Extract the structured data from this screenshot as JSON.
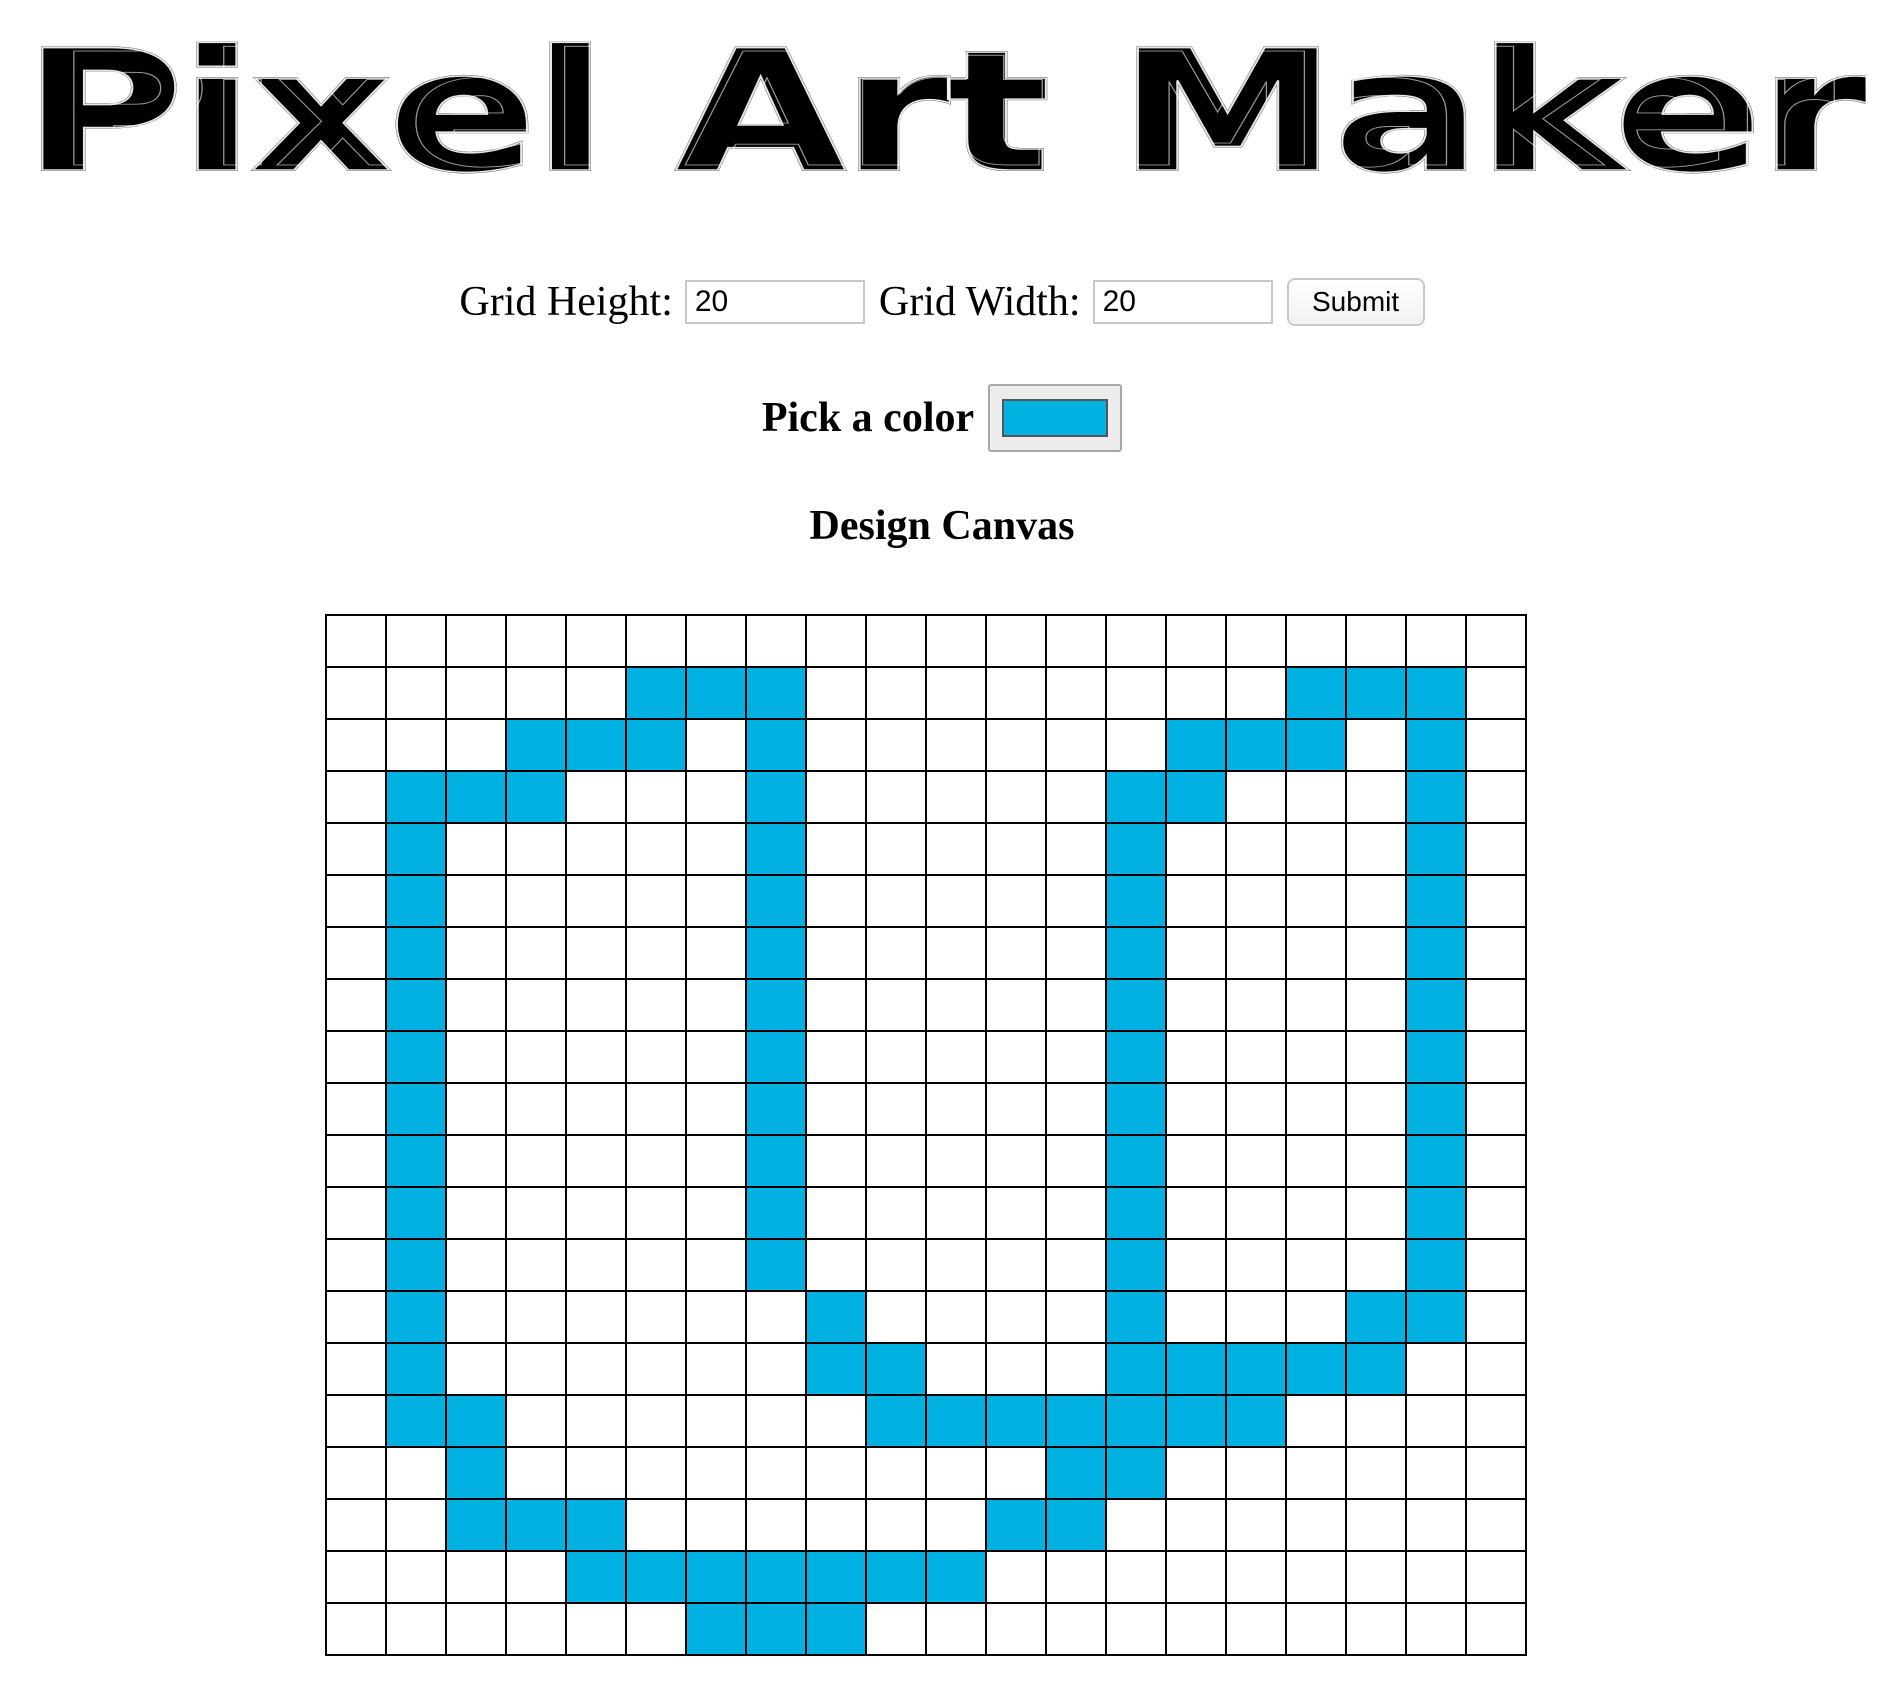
{
  "title": "Pixel Art Maker",
  "size_form": {
    "height_label": "Grid Height:",
    "height_value": "20",
    "width_label": "Grid Width:",
    "width_value": "20",
    "submit_label": "Submit"
  },
  "color_picker": {
    "label": "Pick a color",
    "value": "#00b1e1"
  },
  "canvas": {
    "heading": "Design Canvas",
    "rows": 20,
    "cols": 20,
    "fill_color": "#00b1e1",
    "empty_color": "#ffffff",
    "filled_cells": [
      [
        1,
        5
      ],
      [
        1,
        6
      ],
      [
        1,
        7
      ],
      [
        1,
        16
      ],
      [
        1,
        17
      ],
      [
        1,
        18
      ],
      [
        2,
        3
      ],
      [
        2,
        4
      ],
      [
        2,
        5
      ],
      [
        2,
        7
      ],
      [
        2,
        14
      ],
      [
        2,
        15
      ],
      [
        2,
        16
      ],
      [
        2,
        18
      ],
      [
        3,
        1
      ],
      [
        3,
        2
      ],
      [
        3,
        3
      ],
      [
        3,
        7
      ],
      [
        3,
        13
      ],
      [
        3,
        14
      ],
      [
        3,
        18
      ],
      [
        4,
        1
      ],
      [
        4,
        7
      ],
      [
        4,
        13
      ],
      [
        4,
        18
      ],
      [
        5,
        1
      ],
      [
        5,
        7
      ],
      [
        5,
        13
      ],
      [
        5,
        18
      ],
      [
        6,
        1
      ],
      [
        6,
        7
      ],
      [
        6,
        13
      ],
      [
        6,
        18
      ],
      [
        7,
        1
      ],
      [
        7,
        7
      ],
      [
        7,
        13
      ],
      [
        7,
        18
      ],
      [
        8,
        1
      ],
      [
        8,
        7
      ],
      [
        8,
        13
      ],
      [
        8,
        18
      ],
      [
        9,
        1
      ],
      [
        9,
        7
      ],
      [
        9,
        13
      ],
      [
        9,
        18
      ],
      [
        10,
        1
      ],
      [
        10,
        7
      ],
      [
        10,
        13
      ],
      [
        10,
        18
      ],
      [
        11,
        1
      ],
      [
        11,
        7
      ],
      [
        11,
        13
      ],
      [
        11,
        18
      ],
      [
        12,
        1
      ],
      [
        12,
        7
      ],
      [
        12,
        13
      ],
      [
        12,
        18
      ],
      [
        13,
        1
      ],
      [
        13,
        8
      ],
      [
        13,
        13
      ],
      [
        13,
        17
      ],
      [
        13,
        18
      ],
      [
        14,
        1
      ],
      [
        14,
        8
      ],
      [
        14,
        9
      ],
      [
        14,
        13
      ],
      [
        14,
        14
      ],
      [
        14,
        15
      ],
      [
        14,
        16
      ],
      [
        14,
        17
      ],
      [
        15,
        1
      ],
      [
        15,
        2
      ],
      [
        15,
        9
      ],
      [
        15,
        10
      ],
      [
        15,
        11
      ],
      [
        15,
        12
      ],
      [
        15,
        13
      ],
      [
        15,
        14
      ],
      [
        15,
        15
      ],
      [
        16,
        2
      ],
      [
        16,
        12
      ],
      [
        16,
        13
      ],
      [
        17,
        2
      ],
      [
        17,
        3
      ],
      [
        17,
        4
      ],
      [
        17,
        11
      ],
      [
        17,
        12
      ],
      [
        18,
        4
      ],
      [
        18,
        5
      ],
      [
        18,
        6
      ],
      [
        18,
        7
      ],
      [
        18,
        8
      ],
      [
        18,
        9
      ],
      [
        18,
        10
      ],
      [
        19,
        6
      ],
      [
        19,
        7
      ],
      [
        19,
        8
      ]
    ]
  }
}
